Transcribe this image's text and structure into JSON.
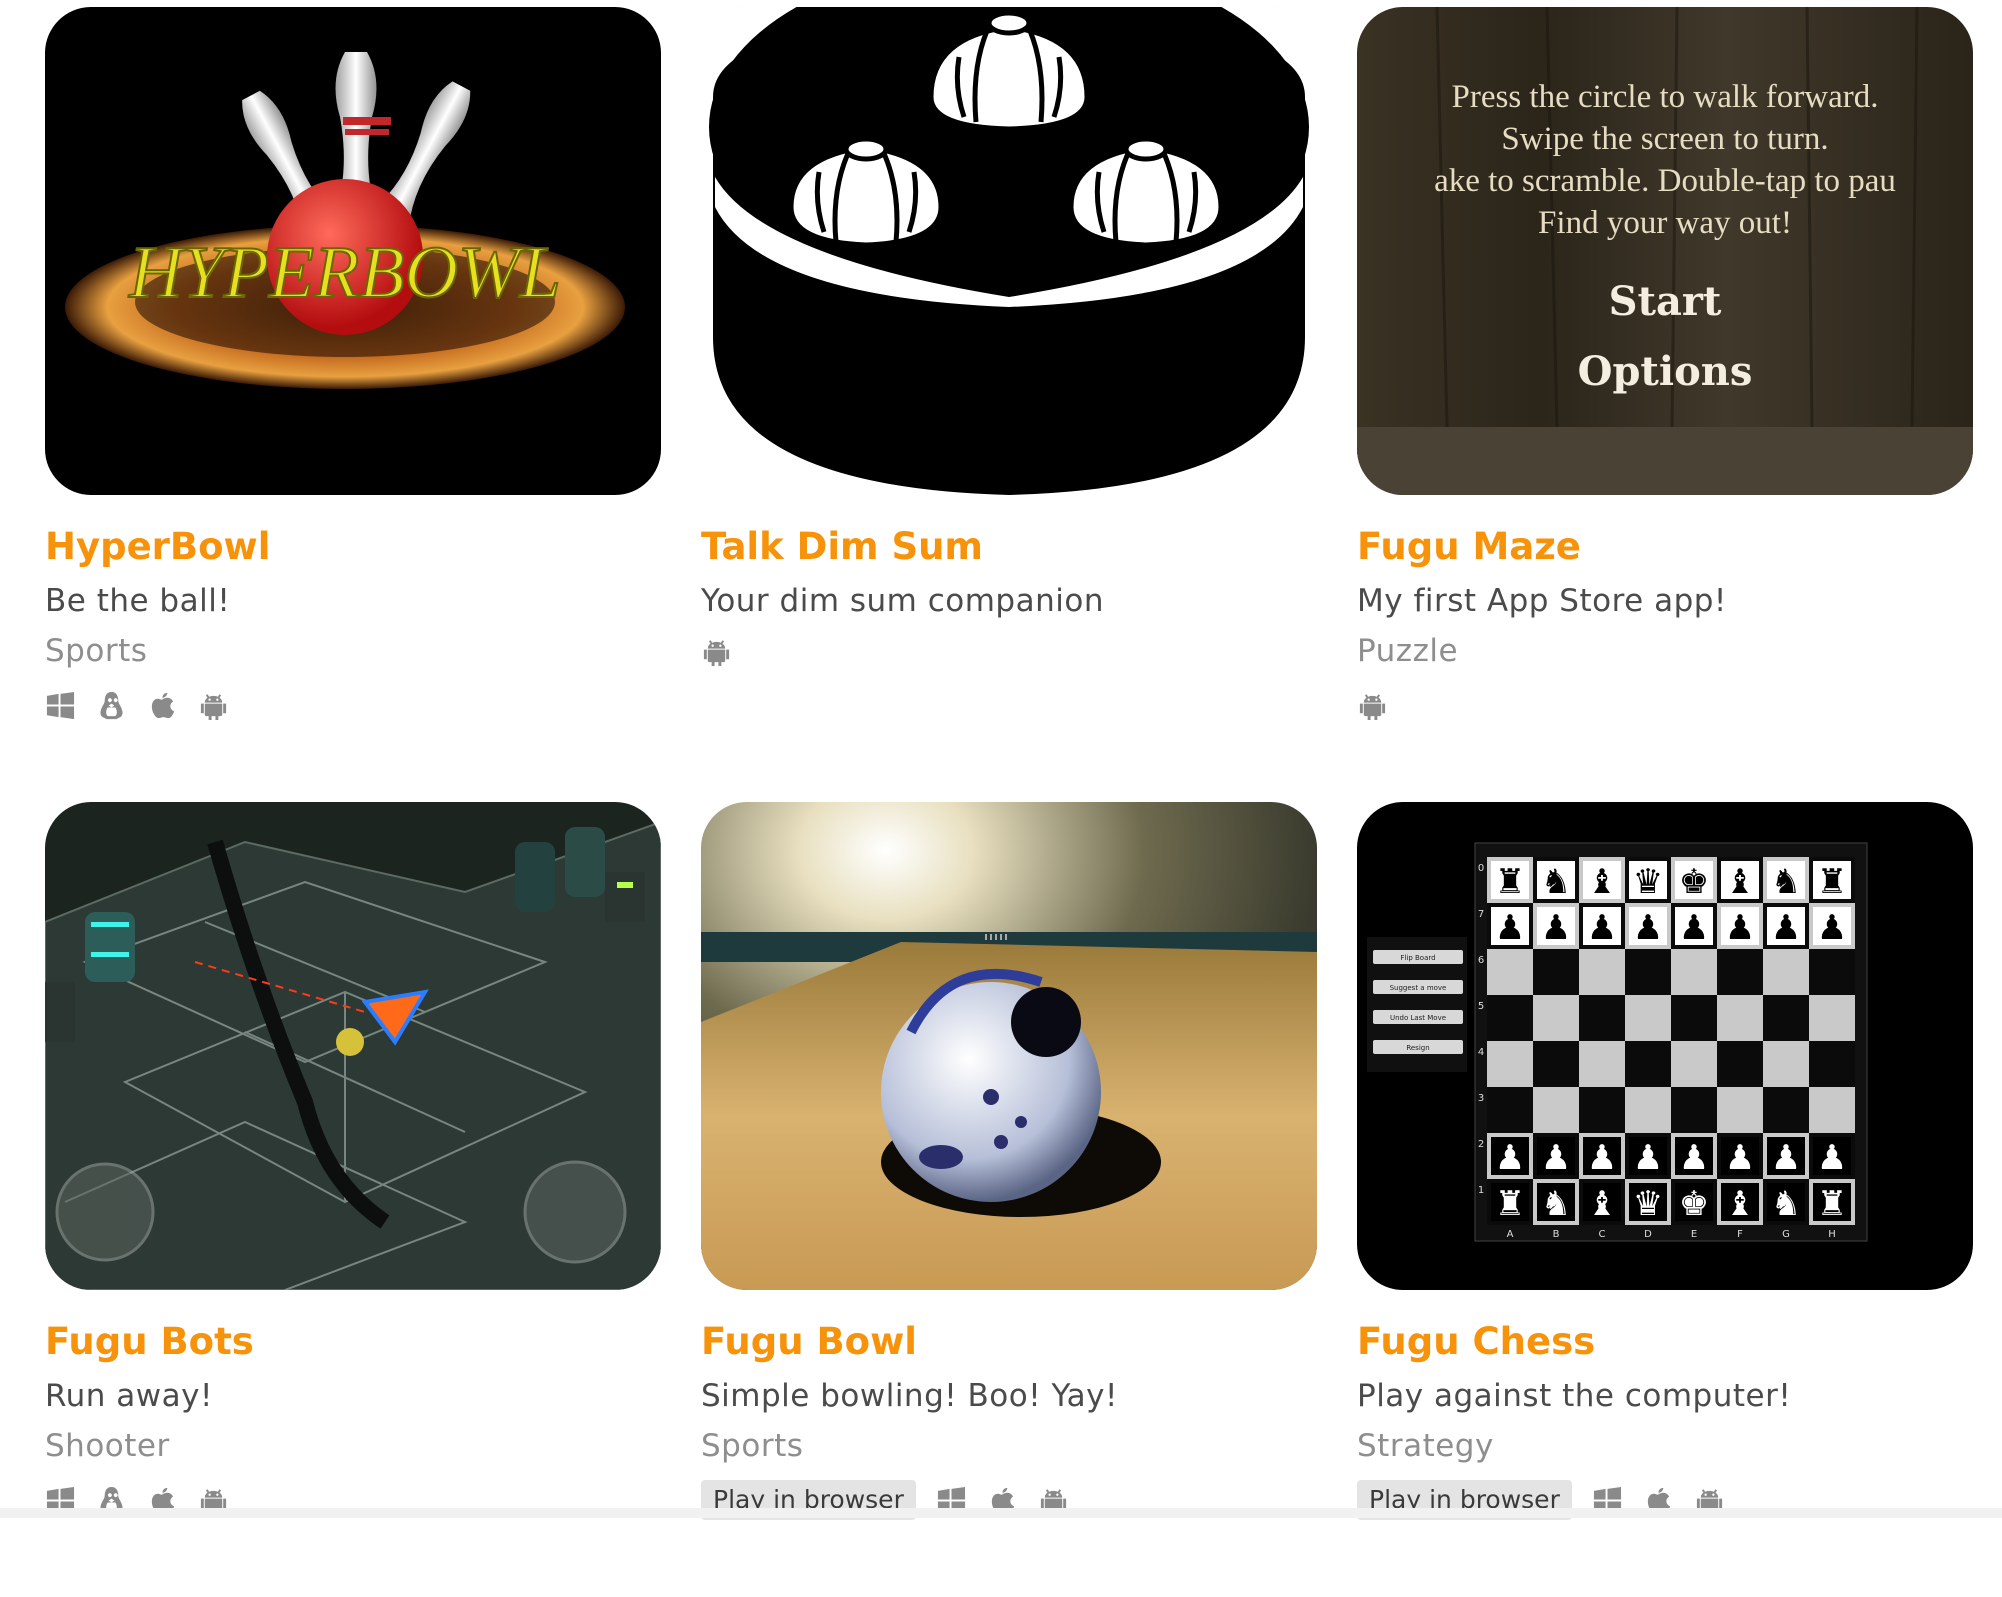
{
  "games": [
    {
      "title": "HyperBowl",
      "tagline": "Be the ball!",
      "genre": "Sports",
      "thumb_text": "HYPERBOWL",
      "platforms": [
        "windows-icon",
        "linux-icon",
        "apple-icon",
        "android-icon"
      ]
    },
    {
      "title": "Talk Dim Sum",
      "tagline": "Your dim sum companion",
      "genre": "",
      "platforms": [
        "android-icon"
      ]
    },
    {
      "title": "Fugu Maze",
      "tagline": "My first App Store app!",
      "genre": "Puzzle",
      "thumb_lines": [
        "Press the circle to walk forward.",
        "Swipe the screen to turn.",
        "ake to scramble. Double-tap to pau",
        "Find your way out!"
      ],
      "thumb_menu": [
        "Start",
        "Options"
      ],
      "platforms": [
        "android-icon"
      ]
    },
    {
      "title": "Fugu Bots",
      "tagline": "Run away!",
      "genre": "Shooter",
      "platforms": [
        "windows-icon",
        "linux-icon",
        "apple-icon",
        "android-icon"
      ]
    },
    {
      "title": "Fugu Bowl",
      "tagline": "Simple bowling! Boo! Yay!",
      "genre": "Sports",
      "play_label": "Play in browser",
      "platforms": [
        "windows-icon",
        "apple-icon",
        "android-icon"
      ]
    },
    {
      "title": "Fugu Chess",
      "tagline": "Play against the computer!",
      "genre": "Strategy",
      "play_label": "Play in browser",
      "thumb_buttons": [
        "Flip Board",
        "Suggest a move",
        "Undo Last Move",
        "Resign"
      ],
      "thumb_files": [
        "A",
        "B",
        "C",
        "D",
        "E",
        "F",
        "G",
        "H"
      ],
      "thumb_ranks": [
        "0",
        "7",
        "6",
        "5",
        "4",
        "3",
        "2",
        "1"
      ],
      "platforms": [
        "windows-icon",
        "apple-icon",
        "android-icon"
      ]
    }
  ],
  "colors": {
    "title": "#f7930a",
    "tagline": "#4b4b4b",
    "genre": "#8e8e8e",
    "icon": "#8a8a8a"
  }
}
